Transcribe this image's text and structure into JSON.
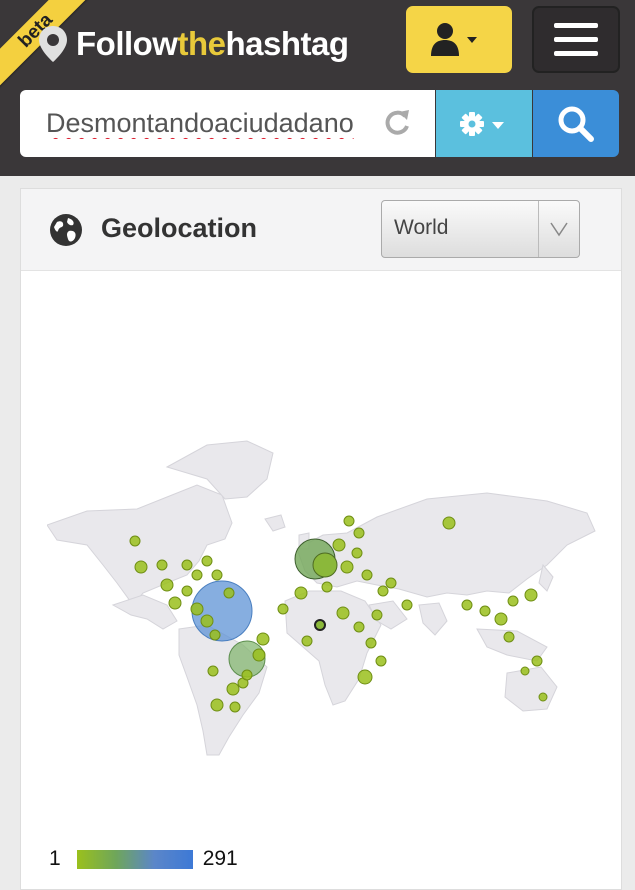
{
  "header": {
    "badge": "beta",
    "logo_text_1": "Follow",
    "logo_text_2": "the",
    "logo_text_3": "hashtag",
    "accent_color": "#f5d547",
    "user_button_icon": "user-icon",
    "menu_button_icon": "hamburger-icon"
  },
  "search": {
    "value": "Desmontandoaciudadano",
    "refresh_icon": "refresh-icon",
    "settings_icon": "gear-icon",
    "search_icon": "search-icon"
  },
  "geolocation": {
    "title": "Geolocation",
    "region": "World",
    "legend_min": "1",
    "legend_max": "291",
    "colors": {
      "low": "#9ac01c",
      "high": "#3d79d6"
    }
  }
}
